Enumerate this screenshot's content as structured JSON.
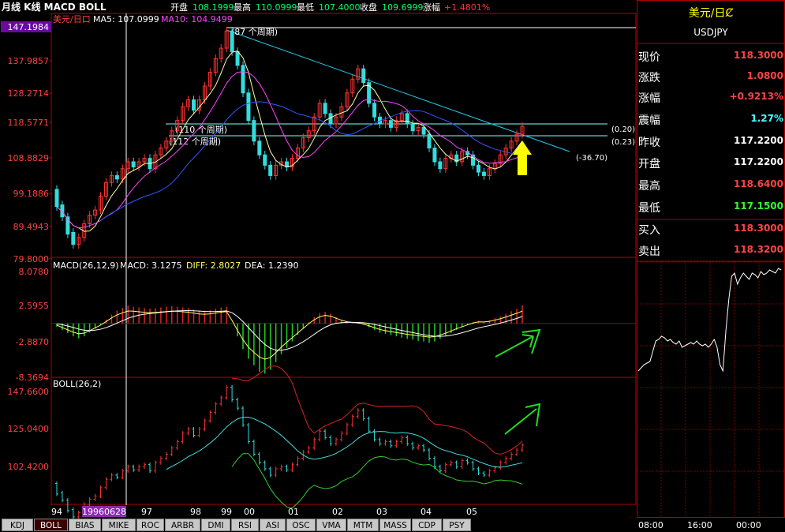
{
  "header": {
    "title": "月线 K线 MACD BOLL",
    "open_label": "开盘",
    "open_value": "108.1999",
    "high_label": "最高",
    "high_value": "110.0999",
    "low_label": "最低",
    "low_value": "107.4000",
    "close_label": "收盘",
    "close_value": "109.6999",
    "change_label": "涨幅",
    "change_value": "+1.4801%"
  },
  "main_panel": {
    "pair_label": "美元/日口",
    "ma5_label": "MA5: 107.0999",
    "ma10_label": "MA10: 104.9499",
    "highlight_price": "147.1984",
    "y_ticks": [
      "137.9857",
      "128.2714",
      "118.5771",
      "108.8829",
      "99.1886",
      "89.4943",
      "79.8000"
    ],
    "annotations": [
      "(87 个周期)",
      "(110 个周期)",
      "(112 个周期)",
      "(0.20)",
      "(0.23)",
      "(-36.70)"
    ]
  },
  "macd_panel": {
    "title": "MACD(26,12,9)",
    "macd_label": "MACD: 3.1275",
    "diff_label": "DIFF: 2.8027",
    "dea_label": "DEA: 1.2390",
    "y_ticks": [
      "8.0780",
      "2.5955",
      "-2.8870",
      "-8.3694"
    ]
  },
  "boll_panel": {
    "title": "BOLL(26,2)",
    "y_ticks": [
      "147.6600",
      "125.0400",
      "102.4200"
    ]
  },
  "x_axis": {
    "labels": [
      "94",
      "97",
      "98",
      "99",
      "00",
      "01",
      "02",
      "03",
      "04",
      "05"
    ],
    "cursor_date": "19960628"
  },
  "chart_data": {
    "type": "candlestick",
    "title": "美元/日口",
    "period": "monthly",
    "ylim": [
      79.8,
      147.1984
    ],
    "macd_ylim": [
      -8.3694,
      8.078
    ],
    "boll_ylim": [
      95,
      150
    ],
    "candles_approx": [
      {
        "o": 100.0,
        "c": 95.0
      },
      {
        "o": 95.5,
        "c": 92.0
      },
      {
        "o": 92.0,
        "c": 87.0
      },
      {
        "o": 87.5,
        "c": 84.0
      },
      {
        "o": 84.0,
        "c": 86.0
      },
      {
        "o": 86.0,
        "c": 90.0
      },
      {
        "o": 90.0,
        "c": 92.5
      },
      {
        "o": 92.5,
        "c": 94.0
      },
      {
        "o": 94.0,
        "c": 98.0
      },
      {
        "o": 98.0,
        "c": 102.0
      },
      {
        "o": 102.0,
        "c": 104.0
      },
      {
        "o": 104.0,
        "c": 103.0
      },
      {
        "o": 103.0,
        "c": 106.0
      },
      {
        "o": 106.0,
        "c": 108.0
      },
      {
        "o": 108.0,
        "c": 106.5
      },
      {
        "o": 106.5,
        "c": 108.0
      },
      {
        "o": 108.0,
        "c": 109.0
      },
      {
        "o": 109.0,
        "c": 106.0
      },
      {
        "o": 106.0,
        "c": 110.0
      },
      {
        "o": 110.0,
        "c": 112.0
      },
      {
        "o": 112.0,
        "c": 114.0
      },
      {
        "o": 114.0,
        "c": 117.0
      },
      {
        "o": 117.0,
        "c": 120.0
      },
      {
        "o": 120.0,
        "c": 124.0
      },
      {
        "o": 124.0,
        "c": 126.0
      },
      {
        "o": 126.0,
        "c": 123.0
      },
      {
        "o": 123.0,
        "c": 126.0
      },
      {
        "o": 126.0,
        "c": 130.0
      },
      {
        "o": 130.0,
        "c": 134.0
      },
      {
        "o": 134.0,
        "c": 138.0
      },
      {
        "o": 138.0,
        "c": 141.0
      },
      {
        "o": 141.0,
        "c": 146.0
      },
      {
        "o": 146.0,
        "c": 140.0
      },
      {
        "o": 140.0,
        "c": 136.0
      },
      {
        "o": 136.0,
        "c": 128.0
      },
      {
        "o": 128.0,
        "c": 120.0
      },
      {
        "o": 120.0,
        "c": 114.0
      },
      {
        "o": 114.0,
        "c": 110.0
      },
      {
        "o": 110.0,
        "c": 107.0
      },
      {
        "o": 107.0,
        "c": 104.0
      },
      {
        "o": 104.0,
        "c": 107.0
      },
      {
        "o": 107.0,
        "c": 108.0
      },
      {
        "o": 108.0,
        "c": 106.5
      },
      {
        "o": 106.5,
        "c": 109.0
      },
      {
        "o": 109.0,
        "c": 112.0
      },
      {
        "o": 112.0,
        "c": 115.0
      },
      {
        "o": 115.0,
        "c": 117.0
      },
      {
        "o": 117.0,
        "c": 121.0
      },
      {
        "o": 121.0,
        "c": 125.0
      },
      {
        "o": 125.0,
        "c": 122.0
      },
      {
        "o": 122.0,
        "c": 119.0
      },
      {
        "o": 119.0,
        "c": 121.0
      },
      {
        "o": 121.0,
        "c": 124.0
      },
      {
        "o": 124.0,
        "c": 128.0
      },
      {
        "o": 128.0,
        "c": 132.0
      },
      {
        "o": 132.0,
        "c": 135.0
      },
      {
        "o": 135.0,
        "c": 131.0
      },
      {
        "o": 131.0,
        "c": 125.0
      },
      {
        "o": 125.0,
        "c": 121.0
      },
      {
        "o": 121.0,
        "c": 119.0
      },
      {
        "o": 119.0,
        "c": 120.0
      },
      {
        "o": 120.0,
        "c": 118.0
      },
      {
        "o": 118.0,
        "c": 120.0
      },
      {
        "o": 120.0,
        "c": 122.0
      },
      {
        "o": 122.0,
        "c": 119.0
      },
      {
        "o": 119.0,
        "c": 117.0
      },
      {
        "o": 117.0,
        "c": 118.0
      },
      {
        "o": 118.0,
        "c": 116.0
      },
      {
        "o": 116.0,
        "c": 112.0
      },
      {
        "o": 112.0,
        "c": 108.0
      },
      {
        "o": 108.0,
        "c": 106.0
      },
      {
        "o": 106.0,
        "c": 109.0
      },
      {
        "o": 109.0,
        "c": 110.0
      },
      {
        "o": 110.0,
        "c": 108.0
      },
      {
        "o": 108.0,
        "c": 111.0
      },
      {
        "o": 111.0,
        "c": 110.0
      },
      {
        "o": 110.0,
        "c": 107.0
      },
      {
        "o": 107.0,
        "c": 105.0
      },
      {
        "o": 105.0,
        "c": 104.0
      },
      {
        "o": 104.0,
        "c": 106.0
      },
      {
        "o": 106.0,
        "c": 107.5
      },
      {
        "o": 107.5,
        "c": 110.0
      },
      {
        "o": 110.0,
        "c": 112.0
      },
      {
        "o": 112.0,
        "c": 114.0
      },
      {
        "o": 114.0,
        "c": 116.0
      },
      {
        "o": 116.0,
        "c": 118.3
      }
    ],
    "macd_hist_approx": [
      -0.5,
      -1.0,
      -1.5,
      -2.0,
      -2.3,
      -2.0,
      -1.4,
      -0.8,
      -0.2,
      0.6,
      1.4,
      2.0,
      2.4,
      2.8,
      2.6,
      2.5,
      2.4,
      2.3,
      2.4,
      2.5,
      2.6,
      2.7,
      2.6,
      2.5,
      2.4,
      2.2,
      2.0,
      2.0,
      2.1,
      2.3,
      2.5,
      2.6,
      0.0,
      -2.0,
      -4.0,
      -5.5,
      -6.5,
      -7.5,
      -7.8,
      -7.2,
      -6.0,
      -4.8,
      -3.8,
      -2.8,
      -1.8,
      -0.8,
      0.2,
      1.0,
      1.6,
      1.8,
      1.5,
      1.0,
      0.6,
      0.3,
      0.2,
      0.1,
      -0.2,
      -0.6,
      -1.0,
      -1.4,
      -1.6,
      -1.8,
      -2.0,
      -2.2,
      -2.4,
      -2.5,
      -2.7,
      -2.8,
      -3.0,
      -2.8,
      -2.4,
      -2.0,
      -1.5,
      -1.0,
      -0.6,
      -0.2,
      0.2,
      0.4,
      0.3,
      0.5,
      0.8,
      1.1,
      1.5,
      1.9,
      2.3,
      2.8
    ],
    "trend_channel_label": "(87 个周期)"
  }
}
